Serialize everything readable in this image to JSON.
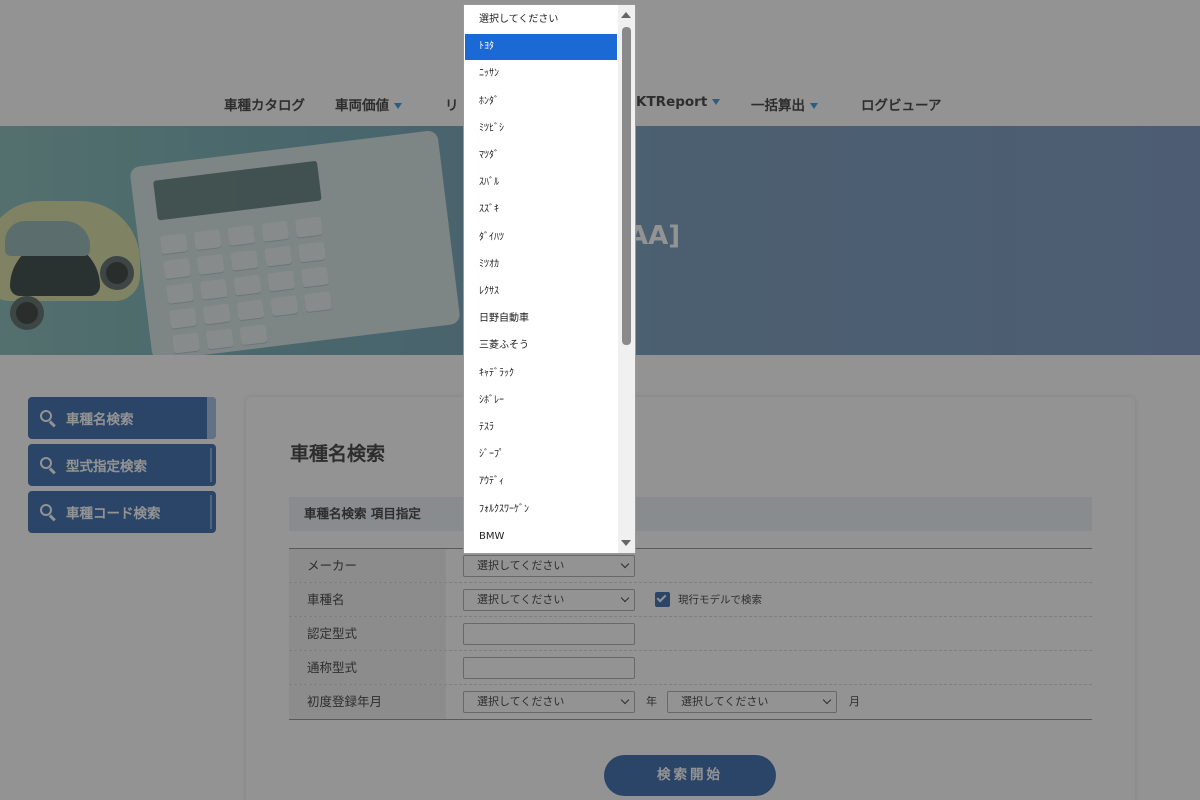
{
  "nav": {
    "items": [
      {
        "label": "車種カタログ",
        "has_arrow": false
      },
      {
        "label": "車両価値",
        "has_arrow": true
      },
      {
        "label": "リ",
        "has_arrow": false
      },
      {
        "label": "KTReport",
        "has_arrow": true
      },
      {
        "label": "一括算出",
        "has_arrow": true
      },
      {
        "label": "ログビューア",
        "has_arrow": false
      }
    ]
  },
  "hero": {
    "title_fragment": "AA]",
    "calculator_keys": [
      "MRC",
      "M-",
      "M+",
      "CE",
      "ON/C",
      "7",
      "8",
      "9",
      "%",
      "÷",
      "4",
      "5",
      "6",
      "×",
      "−",
      "1",
      "2",
      "3",
      "+",
      "=",
      "0",
      "•",
      "+/-"
    ]
  },
  "sidebar": {
    "items": [
      {
        "label": "車種名検索",
        "active": true
      },
      {
        "label": "型式指定検索",
        "active": false
      },
      {
        "label": "車種コード検索",
        "active": false
      }
    ]
  },
  "main": {
    "title": "車種名検索",
    "section_header": "車種名検索 項目指定",
    "form": {
      "maker": {
        "label": "メーカー",
        "value": "選択してください"
      },
      "model": {
        "label": "車種名",
        "value": "選択してください",
        "checkbox_label": "現行モデルで検索",
        "checkbox_checked": true
      },
      "certified_type": {
        "label": "認定型式",
        "value": ""
      },
      "common_type": {
        "label": "通称型式",
        "value": ""
      },
      "first_registration": {
        "label": "初度登録年月",
        "year_value": "選択してください",
        "year_unit": "年",
        "month_value": "選択してください",
        "month_unit": "月"
      }
    },
    "submit_label": "検索開始"
  },
  "dropdown": {
    "options": [
      "選択してください",
      "ﾄﾖﾀ",
      "ﾆｯｻﾝ",
      "ﾎﾝﾀﾞ",
      "ﾐﾂﾋﾞｼ",
      "ﾏﾂﾀﾞ",
      "ｽﾊﾞﾙ",
      "ｽｽﾞｷ",
      "ﾀﾞｲﾊﾂ",
      "ﾐﾂｵｶ",
      "ﾚｸｻｽ",
      "日野自動車",
      "三菱ふそう",
      "ｷｬﾃﾞﾗｯｸ",
      "ｼﾎﾞﾚｰ",
      "ﾃｽﾗ",
      "ｼﾞｰﾌﾟ",
      "ｱｳﾃﾞｨ",
      "ﾌｫﾙｸｽﾜｰｹﾞﾝ",
      "BMW"
    ],
    "selected_index": 1
  },
  "colors": {
    "primary": "#2f62a8",
    "selected_option": "#1a69d4",
    "section_header_bg": "#eaf0f7"
  }
}
